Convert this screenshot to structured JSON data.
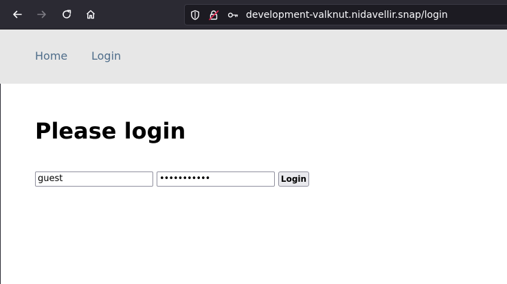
{
  "browser": {
    "url": "development-valknut.nidavellir.snap/login",
    "icons": {
      "back": "arrow-left-icon",
      "forward": "arrow-right-icon",
      "reload": "reload-icon",
      "home": "home-icon",
      "tracking": "shield-icon",
      "insecure": "lock-icon",
      "password": "key-icon"
    },
    "colors": {
      "toolbar": "#2b2a33",
      "urlbar": "#1c1b22",
      "insecure_accent": "#e22850"
    }
  },
  "nav": {
    "links": [
      {
        "label": "Home"
      },
      {
        "label": "Login"
      }
    ],
    "background": "#e7e7e7",
    "link_color": "#4f6d8a"
  },
  "main": {
    "title": "Please login",
    "username_value": "guest",
    "password_value": "•••••••••••",
    "submit_label": "Login"
  }
}
